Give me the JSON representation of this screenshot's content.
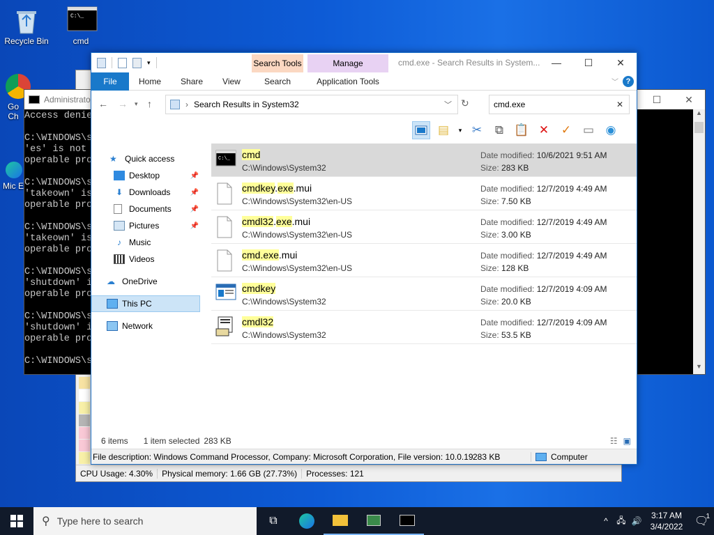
{
  "desktop": {
    "icons": [
      {
        "label": "Recycle Bin",
        "icon": "recycle-bin-icon"
      },
      {
        "label": "cmd",
        "icon": "console-icon"
      },
      {
        "label": "Go Ch",
        "icon": "chrome-icon"
      },
      {
        "label": "Mic E",
        "icon": "edge-icon"
      }
    ]
  },
  "task_manager": {
    "status": {
      "cpu": "CPU Usage: 4.30%",
      "memory": "Physical memory: 1.66 GB (27.73%)",
      "processes": "Processes: 121"
    }
  },
  "console": {
    "title": "Administrato",
    "lines": [
      "Access denie",
      "",
      "C:\\WINDOWS\\s",
      "'es' is not",
      "operable pro",
      "",
      "C:\\WINDOWS\\s",
      "'takeown' is",
      "operable pro",
      "",
      "C:\\WINDOWS\\s",
      "'takeown' is",
      "operable pro",
      "",
      "C:\\WINDOWS\\s",
      "'shutdown' i",
      "operable pro",
      "",
      "C:\\WINDOWS\\s",
      "'shutdown' i",
      "operable pro",
      "",
      "C:\\WINDOWS\\s"
    ]
  },
  "explorer": {
    "window_title": "cmd.exe - Search Results in System...",
    "context_tabs": {
      "search_tools": "Search Tools",
      "manage": "Manage"
    },
    "ribbon_tabs": {
      "file": "File",
      "home": "Home",
      "share": "Share",
      "view": "View",
      "search": "Search",
      "application_tools": "Application Tools"
    },
    "address": "Search Results in System32",
    "search_value": "cmd.exe",
    "nav": {
      "quick_access": "Quick access",
      "desktop": "Desktop",
      "downloads": "Downloads",
      "documents": "Documents",
      "pictures": "Pictures",
      "music": "Music",
      "videos": "Videos",
      "onedrive": "OneDrive",
      "this_pc": "This PC",
      "network": "Network"
    },
    "labels": {
      "date_modified": "Date modified:",
      "size": "Size:"
    },
    "results": [
      {
        "name_parts": [
          "cmd"
        ],
        "path": "C:\\Windows\\System32",
        "date": "10/6/2021 9:51 AM",
        "size": "283 KB",
        "icon": "console-app-icon"
      },
      {
        "name_parts": [
          "cmdkey",
          ".",
          "exe",
          ".mui"
        ],
        "path": "C:\\Windows\\System32\\en-US",
        "date": "12/7/2019 4:49 AM",
        "size": "7.50 KB",
        "icon": "blank-file-icon"
      },
      {
        "name_parts": [
          "cmdl32",
          ".",
          "exe",
          ".mui"
        ],
        "path": "C:\\Windows\\System32\\en-US",
        "date": "12/7/2019 4:49 AM",
        "size": "3.00 KB",
        "icon": "blank-file-icon"
      },
      {
        "name_parts": [
          "cmd.exe",
          ".mui"
        ],
        "path": "C:\\Windows\\System32\\en-US",
        "date": "12/7/2019 4:49 AM",
        "size": "128 KB",
        "icon": "blank-file-icon"
      },
      {
        "name_parts": [
          "cmdkey"
        ],
        "path": "C:\\Windows\\System32",
        "date": "12/7/2019 4:09 AM",
        "size": "20.0 KB",
        "icon": "window-app-icon"
      },
      {
        "name_parts": [
          "cmdl32"
        ],
        "path": "C:\\Windows\\System32",
        "date": "12/7/2019 4:09 AM",
        "size": "53.5 KB",
        "icon": "dialer-app-icon"
      }
    ],
    "status": {
      "items": "6 items",
      "selected": "1 item selected",
      "selected_size": "283 KB"
    },
    "description_bar": {
      "text": "File description: Windows Command Processor, Company: Microsoft Corporation, File version: 10.0.19(",
      "size": "283 KB",
      "location": "Computer"
    }
  },
  "taskbar": {
    "search_placeholder": "Type here to search",
    "time": "3:17 AM",
    "date": "3/4/2022",
    "notification_count": "1"
  },
  "colors": {
    "accent": "#1979ca",
    "highlight": "#ffff9a",
    "search_tools_tab": "#fbd8c2",
    "manage_tab": "#e8d2f3"
  }
}
